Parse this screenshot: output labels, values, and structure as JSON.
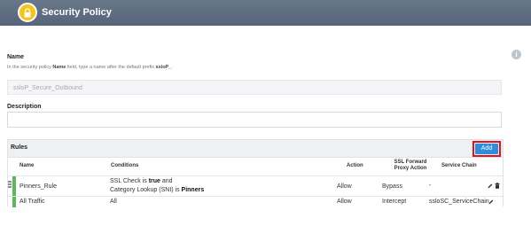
{
  "header": {
    "title": "Security Policy",
    "icon": "lock-icon",
    "background": "#5f6d82",
    "badge_color": "#f5c518"
  },
  "name_section": {
    "label": "Name",
    "hint_prefix": "In the security policy ",
    "hint_field": "Name",
    "hint_middle": " field, type a name after the default prefix ",
    "hint_prefix_value": "ssloP_",
    "hint_suffix": ".",
    "value": "ssloP_Secure_Outbound"
  },
  "description_section": {
    "label": "Description",
    "value": ""
  },
  "rules": {
    "title": "Rules",
    "add_label": "Add",
    "add_color": "#2f8ed9",
    "highlight_color": "#e3121b",
    "columns": {
      "name": "Name",
      "conditions": "Conditions",
      "action": "Action",
      "ssl_action_line1": "SSL Forward",
      "ssl_action_line2": "Proxy Action",
      "service_chain": "Service Chain"
    },
    "rows": [
      {
        "name": "Pinners_Rule",
        "condition_line1_text": "SSL Check  is ",
        "condition_line1_value": "true",
        "condition_line1_join": "   and",
        "condition_line2_text": "Category Lookup (SNI)  is ",
        "condition_line2_value": "Pinners",
        "action": "Allow",
        "ssl_action": "Bypass",
        "service_chain": "-"
      },
      {
        "name": "All Traffic",
        "conditions": "All",
        "action": "Allow",
        "ssl_action": "Intercept",
        "service_chain": "ssloSC_ServiceChain"
      }
    ],
    "status_color": "#5cb85c"
  }
}
